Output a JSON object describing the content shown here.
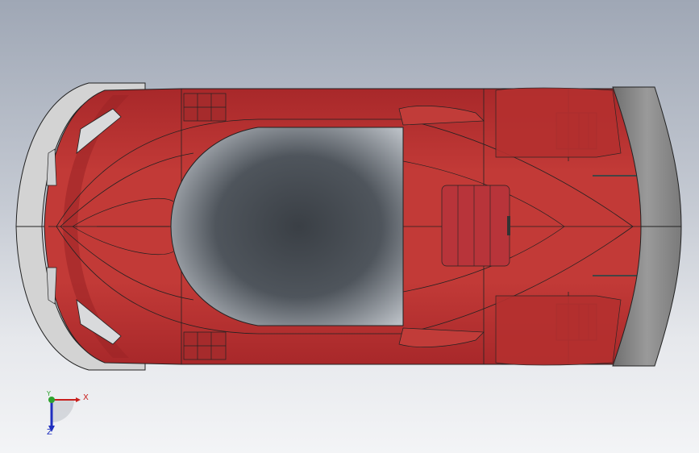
{
  "viewport": {
    "background_top": "#9fa7b5",
    "background_bottom": "#f3f4f6"
  },
  "model": {
    "body_color": "#b5302f",
    "body_shadow_color": "#8f2223",
    "canopy_color": "#2b2f34",
    "front_splitter_color": "#d3d3d3",
    "rear_wing_color": "#7d7d7d"
  },
  "triad": {
    "x_label": "X",
    "y_label": "Y",
    "z_label": "Z",
    "x_color": "#c8201e",
    "y_color": "#2fa32f",
    "z_color": "#1f2fbf"
  }
}
